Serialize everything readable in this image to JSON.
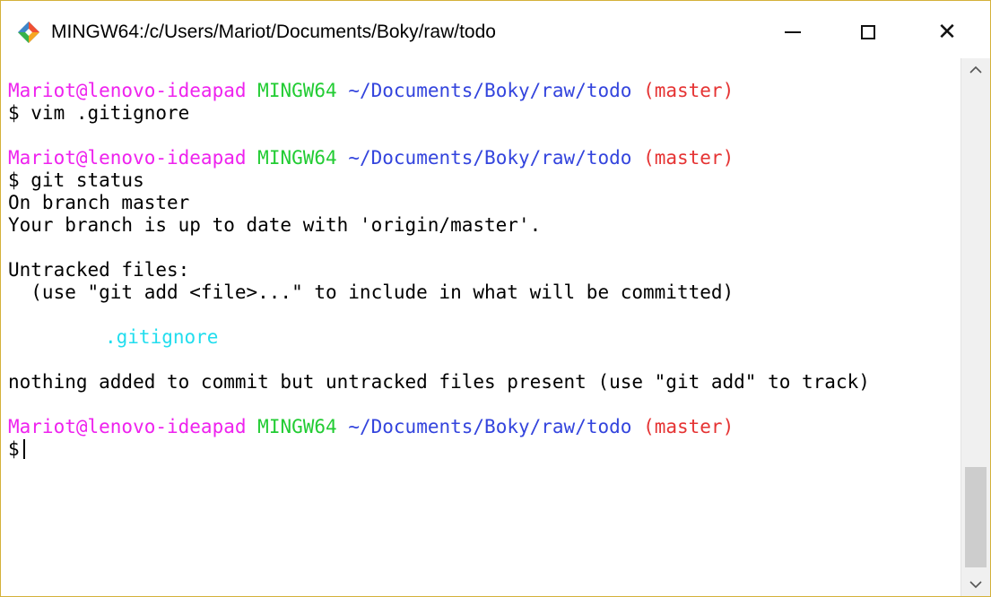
{
  "window": {
    "title": "MINGW64:/c/Users/Mariot/Documents/Boky/raw/todo",
    "icon": "git-bash-icon",
    "controls": {
      "minimize_icon": "minimize-icon",
      "maximize_icon": "maximize-icon",
      "close": "✕"
    }
  },
  "terminal": {
    "prompt1": {
      "user": "Mariot@lenovo-ideapad",
      "host": "MINGW64",
      "path": "~/Documents/Boky/raw/todo",
      "branch": "(master)"
    },
    "cmd1": "$ vim .gitignore",
    "prompt2": {
      "user": "Mariot@lenovo-ideapad",
      "host": "MINGW64",
      "path": "~/Documents/Boky/raw/todo",
      "branch": "(master)"
    },
    "cmd2": "$ git status",
    "out1": "On branch master",
    "out2": "Your branch is up to date with 'origin/master'.",
    "out3": "Untracked files:",
    "out4": "  (use \"git add <file>...\" to include in what will be committed)",
    "untracked_file": ".gitignore",
    "out5": "nothing added to commit but untracked files present (use \"git add\" to track)",
    "prompt3": {
      "user": "Mariot@lenovo-ideapad",
      "host": "MINGW64",
      "path": "~/Documents/Boky/raw/todo",
      "branch": "(master)"
    },
    "cmd3": "$"
  },
  "scrollbar": {
    "up": "^",
    "down": "v"
  },
  "colors": {
    "user": "#ee22ee",
    "host": "#22cc33",
    "path": "#3344dd",
    "branch": "#e53333",
    "untracked": "#22ddee",
    "window_border": "#d4b13a"
  }
}
